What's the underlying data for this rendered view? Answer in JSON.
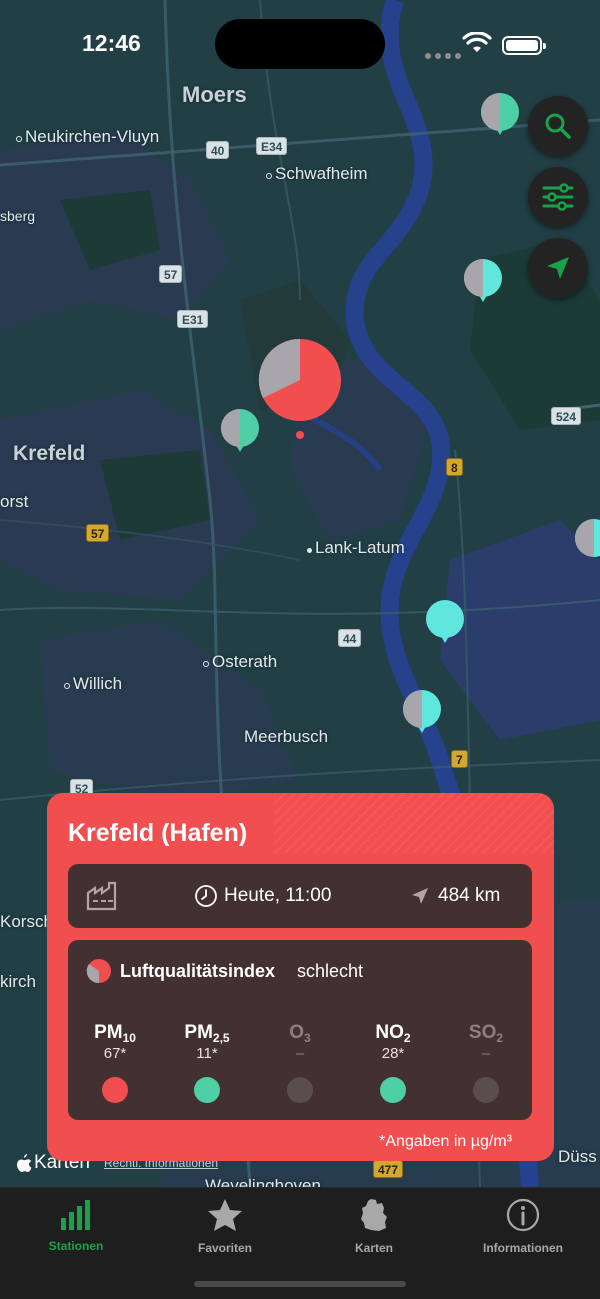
{
  "status": {
    "time": "12:46"
  },
  "map": {
    "places": {
      "moers": "Moers",
      "neukirchen": "Neukirchen-Vluyn",
      "schwafheim": "Schwafheim",
      "sberg": "sberg",
      "krefeld": "Krefeld",
      "orst": "orst",
      "lank": "Lank-Latum",
      "osterath": "Osterath",
      "willich": "Willich",
      "meerbusch": "Meerbusch",
      "korsch": "Korsch",
      "kirch": "kirch",
      "duss": "Düss",
      "wevelinghoven": "Wevelinghoven"
    },
    "roads": {
      "r40": "40",
      "e34": "E34",
      "r57a": "57",
      "e31": "E31",
      "r57b": "57",
      "r524": "524",
      "r8": "8",
      "r44": "44",
      "r7": "7",
      "r52": "52",
      "r477": "477"
    }
  },
  "controls": {
    "search": "search-icon",
    "filter": "sliders-icon",
    "locate": "location-arrow-icon"
  },
  "station_card": {
    "title": "Krefeld (Hafen)",
    "time": "Heute, 11:00",
    "distance": "484 km",
    "aqi_label": "Luftqualitätsindex",
    "aqi_value": "schlecht",
    "pollutants": [
      {
        "name": "PM",
        "sub": "10",
        "value": "67*",
        "color": "#f14f4f"
      },
      {
        "name": "PM",
        "sub": "2,5",
        "value": "11*",
        "color": "#4ecfa6"
      },
      {
        "name": "O",
        "sub": "3",
        "value": "–",
        "color": "#5a4d4d"
      },
      {
        "name": "NO",
        "sub": "2",
        "value": "28*",
        "color": "#4ecfa6"
      },
      {
        "name": "SO",
        "sub": "2",
        "value": "–",
        "color": "#5a4d4d"
      }
    ],
    "footnote": "*Angaben in µg/m³"
  },
  "legal": {
    "brand": "Karten",
    "link": "Rechtl. Informationen"
  },
  "tabs": [
    {
      "label": "Stationen",
      "icon": "bar-chart-icon",
      "active": true
    },
    {
      "label": "Favoriten",
      "icon": "star-icon",
      "active": false
    },
    {
      "label": "Karten",
      "icon": "germany-map-icon",
      "active": false
    },
    {
      "label": "Informationen",
      "icon": "info-icon",
      "active": false
    }
  ],
  "colors": {
    "accent": "#1aa24a",
    "alert": "#f14f4f",
    "good": "#4ecfa6",
    "neutral": "#5a4d4d"
  }
}
